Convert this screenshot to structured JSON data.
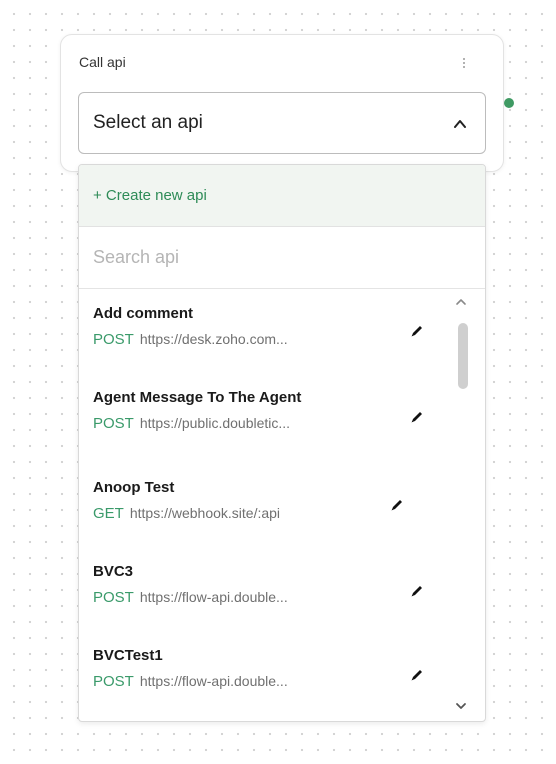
{
  "node": {
    "title": "Call api"
  },
  "select": {
    "value": "Select an api"
  },
  "dropdown": {
    "create_label": "+ Create new api",
    "search_placeholder": "Search api",
    "items": [
      {
        "name": "Add comment",
        "method": "POST",
        "url": "https://desk.zoho.com..."
      },
      {
        "name": "Agent Message To The Agent",
        "method": "POST",
        "url": "https://public.doubletic..."
      },
      {
        "name": "Anoop Test",
        "method": "GET",
        "url": "https://webhook.site/:api"
      },
      {
        "name": "BVC3",
        "method": "POST",
        "url": "https://flow-api.double..."
      },
      {
        "name": "BVCTest1",
        "method": "POST",
        "url": "https://flow-api.double..."
      }
    ]
  },
  "colors": {
    "accent_green": "#2e8b57",
    "method_green": "#3a9a6a",
    "connector_green": "#3f9a63",
    "create_row_bg": "#f1f5f1"
  },
  "icons": {
    "menu": "kebab-menu-icon",
    "select_toggle": "chevron-up-icon",
    "edit": "pencil-icon",
    "scroll_up": "scroll-up-icon",
    "scroll_down": "scroll-down-icon"
  }
}
